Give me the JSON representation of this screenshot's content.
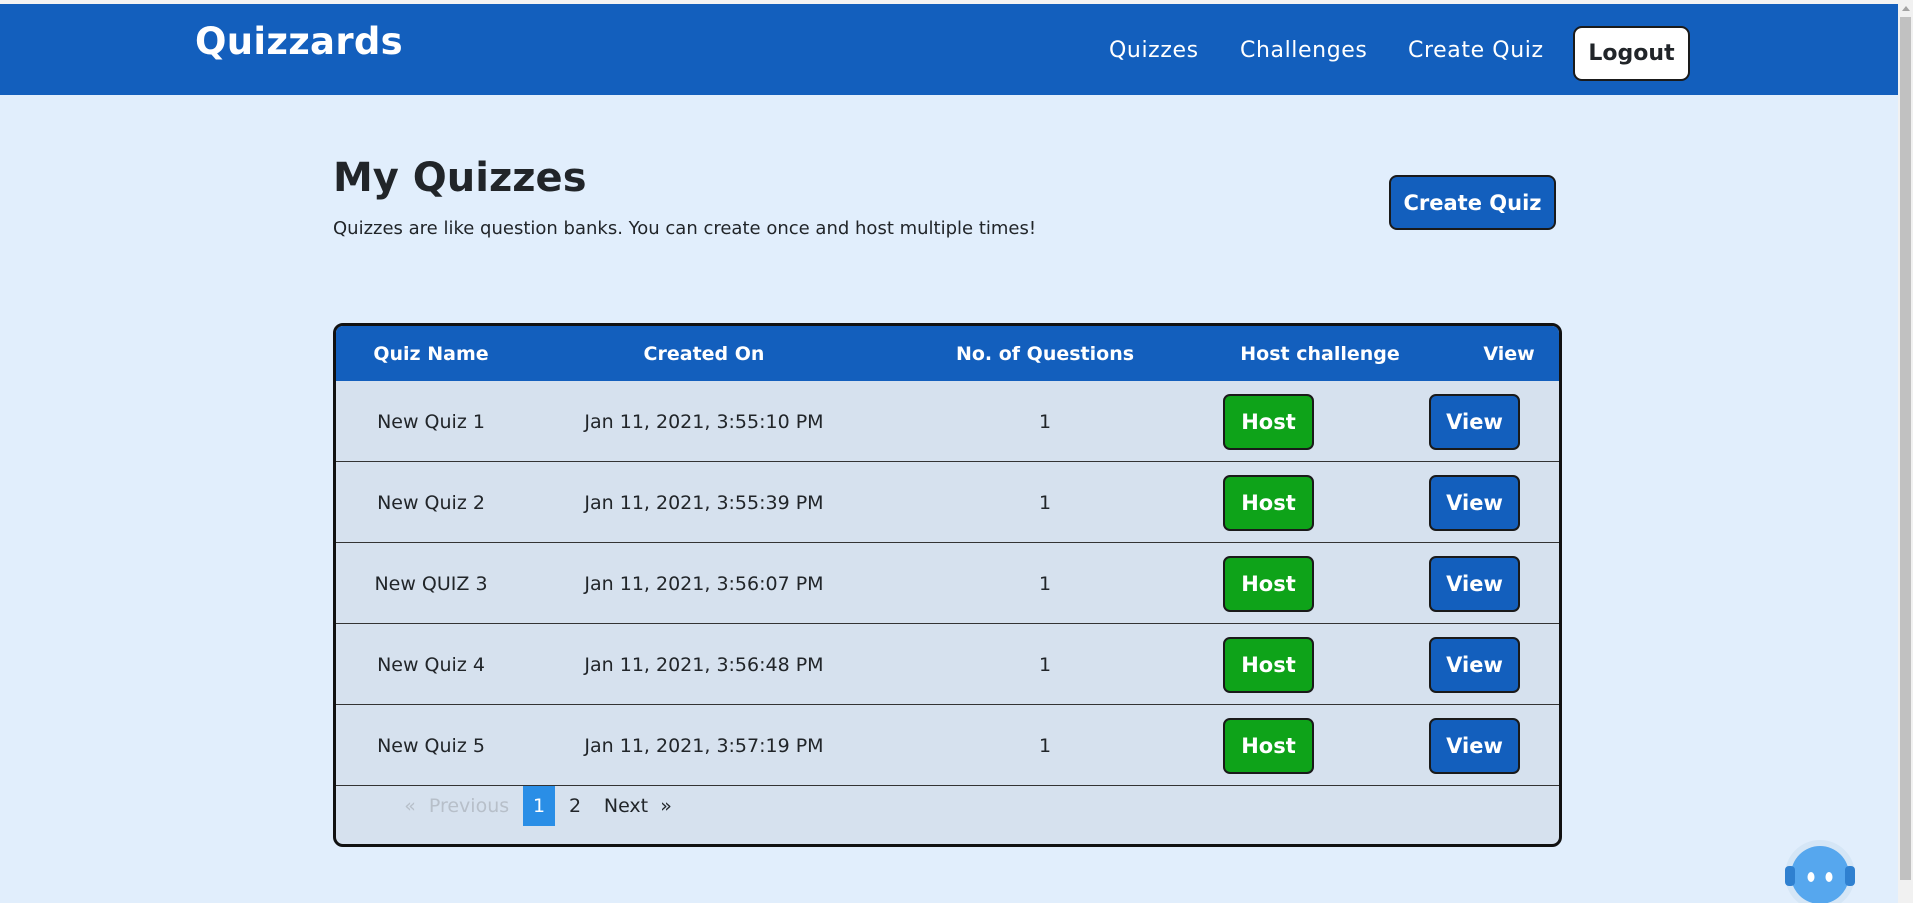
{
  "navbar": {
    "brand": "Quizzards",
    "links": [
      "Quizzes",
      "Challenges",
      "Create Quiz"
    ],
    "logout_label": "Logout"
  },
  "header": {
    "title": "My Quizzes",
    "subtitle": "Quizzes are like question banks. You can create once and host multiple times!",
    "create_label": "Create Quiz"
  },
  "table": {
    "columns": [
      "Quiz Name",
      "Created On",
      "No. of Questions",
      "Host challenge",
      "View"
    ],
    "rows": [
      {
        "name": "New Quiz 1",
        "created": "Jan 11, 2021, 3:55:10 PM",
        "questions": "1",
        "host": "Host",
        "view": "View"
      },
      {
        "name": "New Quiz 2",
        "created": "Jan 11, 2021, 3:55:39 PM",
        "questions": "1",
        "host": "Host",
        "view": "View"
      },
      {
        "name": "New QUIZ 3",
        "created": "Jan 11, 2021, 3:56:07 PM",
        "questions": "1",
        "host": "Host",
        "view": "View"
      },
      {
        "name": "New Quiz 4",
        "created": "Jan 11, 2021, 3:56:48 PM",
        "questions": "1",
        "host": "Host",
        "view": "View"
      },
      {
        "name": "New Quiz 5",
        "created": "Jan 11, 2021, 3:57:19 PM",
        "questions": "1",
        "host": "Host",
        "view": "View"
      }
    ]
  },
  "pagination": {
    "prev_icon": "«",
    "prev_label": "Previous",
    "pages": [
      "1",
      "2"
    ],
    "current": "1",
    "next_label": "Next",
    "next_icon": "»"
  },
  "colors": {
    "navbar": "#135fbd",
    "page_background": "#e1eefc",
    "host_button": "#0ea319",
    "view_button": "#135fbd",
    "active_page": "#2a8ee6"
  },
  "icons": {
    "chat": "chatbot-icon"
  }
}
